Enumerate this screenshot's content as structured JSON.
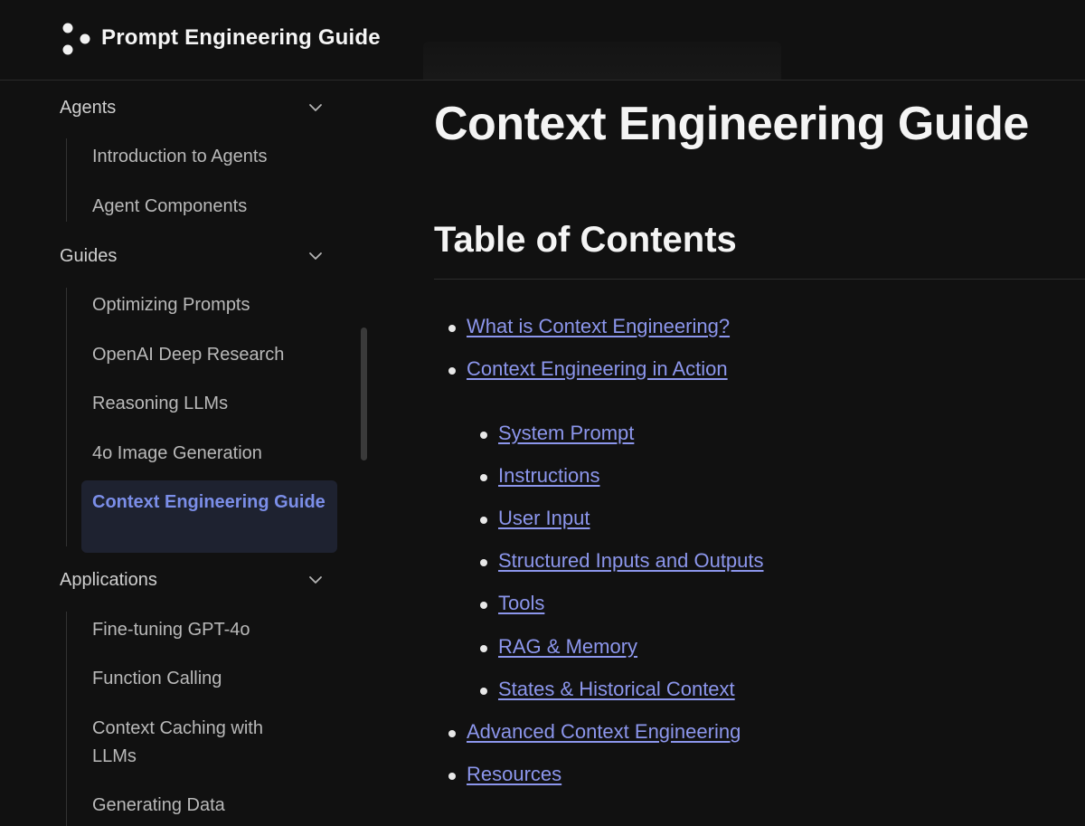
{
  "header": {
    "brand": "Prompt Engineering Guide",
    "logo_icon": "three-dots-logo-icon"
  },
  "sidebar": {
    "sections": [
      {
        "label": "Agents",
        "items": [
          "Introduction to Agents",
          "Agent Components"
        ]
      },
      {
        "label": "Guides",
        "items": [
          "Optimizing Prompts",
          "OpenAI Deep Research",
          "Reasoning LLMs",
          "4o Image Generation",
          "Context Engineering Guide"
        ],
        "active_item": "Context Engineering Guide"
      },
      {
        "label": "Applications",
        "items": [
          "Fine-tuning GPT-4o",
          "Function Calling",
          "Context Caching with LLMs",
          "Generating Data"
        ]
      }
    ]
  },
  "main": {
    "title": "Context Engineering Guide",
    "toc_heading": "Table of Contents",
    "toc": [
      "What is Context Engineering?",
      "Context Engineering in Action",
      "Advanced Context Engineering",
      "Resources"
    ],
    "toc_sub": [
      "System Prompt",
      "Instructions",
      "User Input",
      "Structured Inputs and Outputs",
      "Tools",
      "RAG & Memory",
      "States & Historical Context"
    ]
  },
  "colors": {
    "background": "#111111",
    "link": "#8c96ec",
    "active_text": "#7b8ee8",
    "active_bg": "#1e2230"
  }
}
